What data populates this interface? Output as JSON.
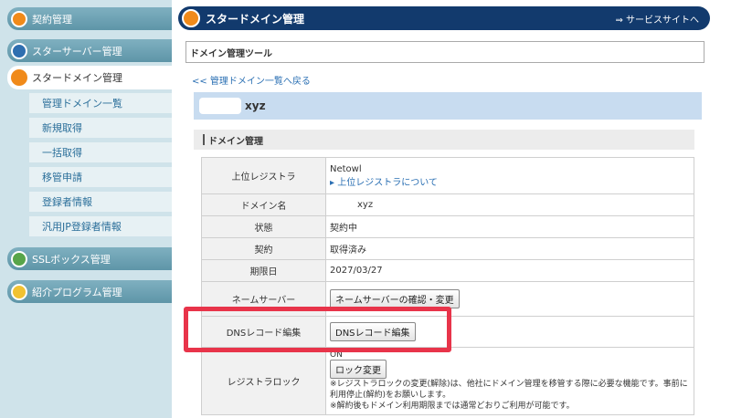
{
  "sidebar": {
    "contract": "契約管理",
    "star_server": "スターサーバー管理",
    "star_domain": "スタードメイン管理",
    "sub_items": [
      "管理ドメイン一覧",
      "新規取得",
      "一括取得",
      "移管申請",
      "登録者情報",
      "汎用JP登録者情報"
    ],
    "ssl": "SSLボックス管理",
    "affiliate": "紹介プログラム管理"
  },
  "header": {
    "title": "スタードメイン管理",
    "service_link": "⇒ サービスサイトへ"
  },
  "tool_title": "ドメイン管理ツール",
  "back_link": "<< 管理ドメイン一覧へ戻る",
  "domain_suffix": "xyz",
  "section_title": "ドメイン管理",
  "table": {
    "registrar_label": "上位レジストラ",
    "registrar_value": "Netowl",
    "registrar_link": "▸ 上位レジストラについて",
    "domain_label": "ドメイン名",
    "domain_value": "xyz",
    "status_label": "状態",
    "status_value": "契約中",
    "contract_label": "契約",
    "contract_value": "取得済み",
    "expiry_label": "期限日",
    "expiry_value": "2027/03/27",
    "ns_label": "ネームサーバー",
    "ns_button": "ネームサーバーの確認・変更",
    "dns_label": "DNSレコード編集",
    "dns_button": "DNSレコード編集",
    "lock_label": "レジストラロック",
    "lock_status": "ON",
    "lock_button": "ロック変更",
    "lock_note1": "※レジストラロックの変更(解除)は、他社にドメイン管理を移管する際に必要な機能です。事前に利用停止(解約)をお願いします。",
    "lock_note2": "※解約後もドメイン利用期限までは通常どおりご利用が可能です。"
  },
  "colors": {
    "header_navy": "#123a6d",
    "sidebar_bg": "#cfe3ea",
    "accent_orange": "#f08a1a",
    "highlight_red": "#e8344a"
  }
}
